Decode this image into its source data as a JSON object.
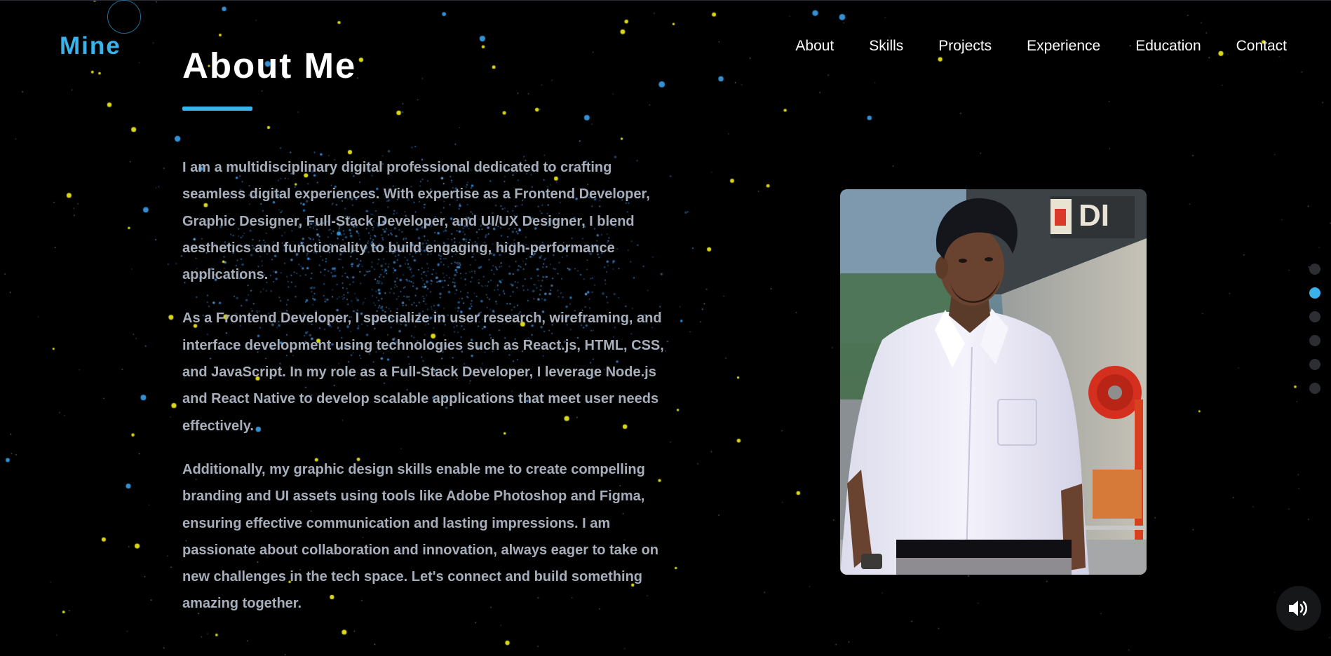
{
  "logo": {
    "text": "Mine"
  },
  "nav": {
    "items": [
      "About",
      "Skills",
      "Projects",
      "Experience",
      "Education",
      "Contact"
    ]
  },
  "section": {
    "title": "About Me",
    "paragraphs": [
      "I am a multidisciplinary digital professional dedicated to crafting seamless digital experiences. With expertise as a Frontend Developer, Graphic Designer, Full-Stack Developer, and UI/UX Designer, I blend aesthetics and functionality to build engaging, high-performance applications.",
      "As a Frontend Developer, I specialize in user research, wireframing, and interface development using technologies such as React.js, HTML, CSS, and JavaScript. In my role as a Full-Stack Developer, I leverage Node.js and React Native to develop scalable applications that meet user needs effectively.",
      "Additionally, my graphic design skills enable me to create compelling branding and UI assets using tools like Adobe Photoshop and Figma, ensuring effective communication and lasting impressions. I am passionate about collaboration and innovation, always eager to take on new challenges in the tech space. Let's connect and build something amazing together."
    ]
  },
  "section_indicator": {
    "count": 6,
    "active_index": 1
  },
  "icons": {
    "sound": "speaker-volume-icon",
    "profile": "profile-photo"
  },
  "colors": {
    "accent": "#3ab3ec",
    "background": "#000000",
    "body_text": "#a7aebb",
    "star_yellow": "#f4f01a",
    "star_blue": "#3a8fe0"
  }
}
